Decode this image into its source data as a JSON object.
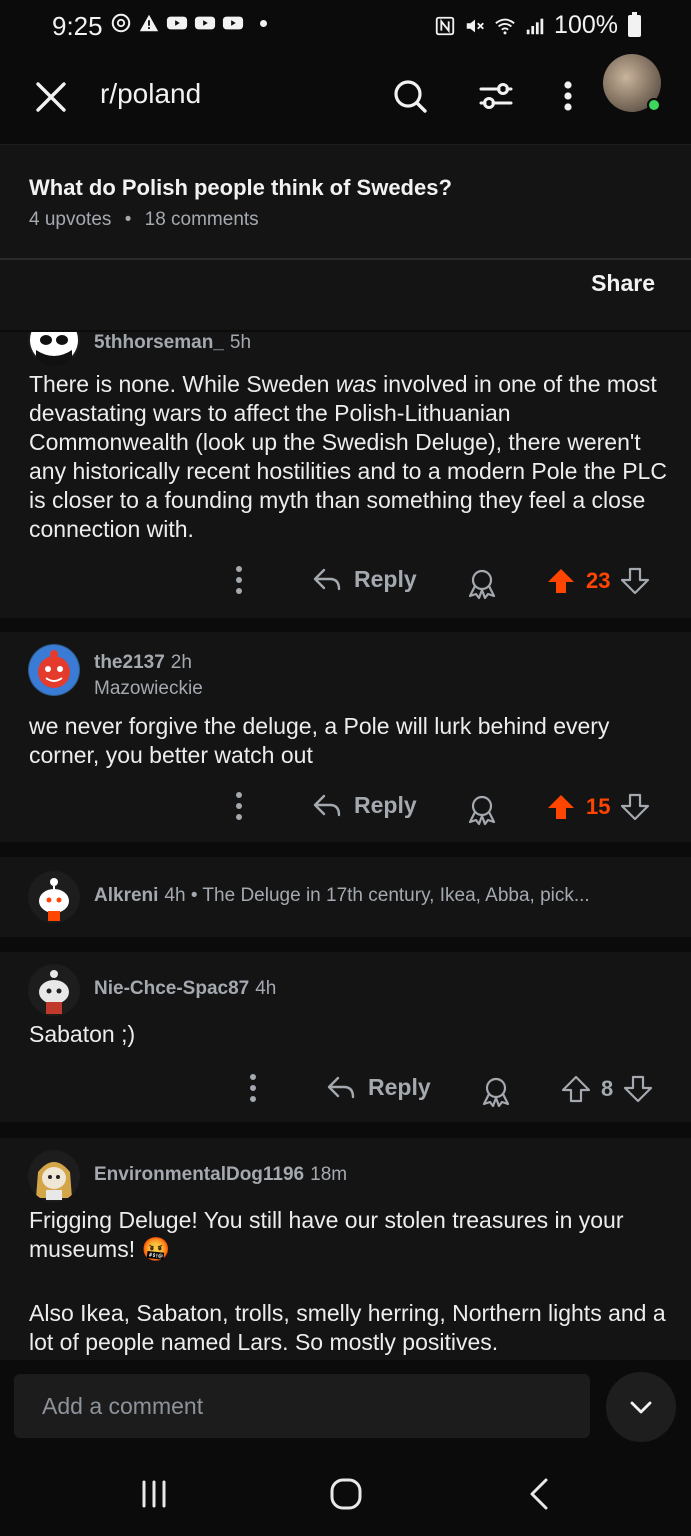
{
  "status_bar": {
    "time": "9:25",
    "battery": "100%",
    "left_icons": [
      "threads-icon",
      "alert-icon",
      "youtube-icon",
      "youtube-icon",
      "youtube-icon",
      "dot-icon"
    ],
    "right_icons": [
      "nfc-icon",
      "mute-icon",
      "wifi-icon",
      "signal-icon",
      "battery-icon"
    ]
  },
  "app_bar": {
    "subreddit": "r/poland",
    "icons": [
      "close-icon",
      "search-icon",
      "filter-icon",
      "more-vertical-icon",
      "avatar"
    ],
    "online_color": "#3bd65b"
  },
  "post": {
    "title": "What do Polish people think of Swedes?",
    "upvotes": "4 upvotes",
    "separator": "•",
    "comments": "18 comments",
    "share_label": "Share"
  },
  "comments": [
    {
      "username": "5thhorseman_",
      "age": "5h",
      "body_before": "There is none. While Sweden ",
      "body_em": "was",
      "body_after": " involved in one of the most devastating wars to affect the Polish-Lithuanian Commonwealth (look up the Swedish Deluge), there weren't any historically recent hostilities and to a modern Pole the PLC is closer to a founding myth than something they feel a close connection with.",
      "reply_label": "Reply",
      "votes": "23",
      "vote_state": "upvoted"
    },
    {
      "username": "the2137",
      "age": "2h",
      "flair": "Mazowieckie",
      "body": "we never forgive the deluge, a Pole will lurk behind every corner, you better watch out",
      "reply_label": "Reply",
      "votes": "15",
      "vote_state": "upvoted"
    },
    {
      "username": "Alkreni",
      "age": "4h",
      "collapsed_preview": "• The Deluge in 17th century, Ikea, Abba, pick...",
      "collapsed": true
    },
    {
      "username": "Nie-Chce-Spac87",
      "age": "4h",
      "body": "Sabaton ;)",
      "reply_label": "Reply",
      "votes": "8",
      "vote_state": "none"
    },
    {
      "username": "EnvironmentalDog1196",
      "age": "18m",
      "body": "Frigging Deluge! You still have our stolen treasures in your museums! 🤬",
      "body2": "Also Ikea, Sabaton, trolls, smelly herring, Northern lights and a lot of people named Lars. So mostly positives."
    }
  ],
  "composer": {
    "placeholder": "Add a comment"
  },
  "colors": {
    "background": "#0b0b0b",
    "card": "#141414",
    "upvote": "#ff4500",
    "meta_text": "#a4a9b0"
  },
  "nav_bar": {
    "icons": [
      "recents-icon",
      "home-icon",
      "back-icon"
    ]
  }
}
